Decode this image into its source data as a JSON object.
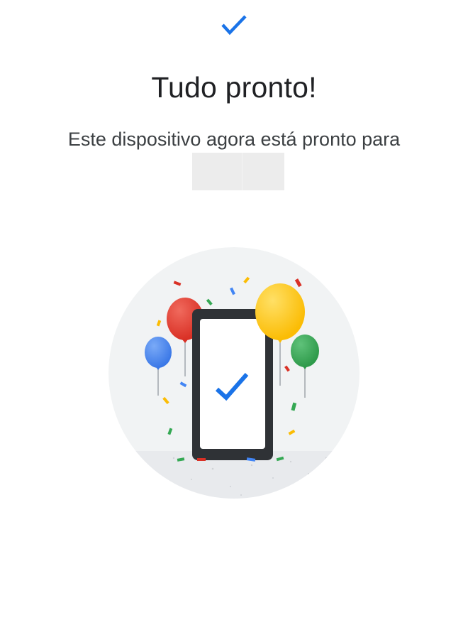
{
  "screen": {
    "title": "Tudo pronto!",
    "subtitle": "Este dispositivo agora está pronto para"
  },
  "icons": {
    "header": "checkmark-icon",
    "illustration": "phone-with-balloons-illustration"
  },
  "colors": {
    "accent_blue": "#1a73e8",
    "balloon_red": "#d93025",
    "balloon_yellow": "#fbbc04",
    "balloon_green": "#34a853",
    "balloon_blue": "#4285f4"
  }
}
